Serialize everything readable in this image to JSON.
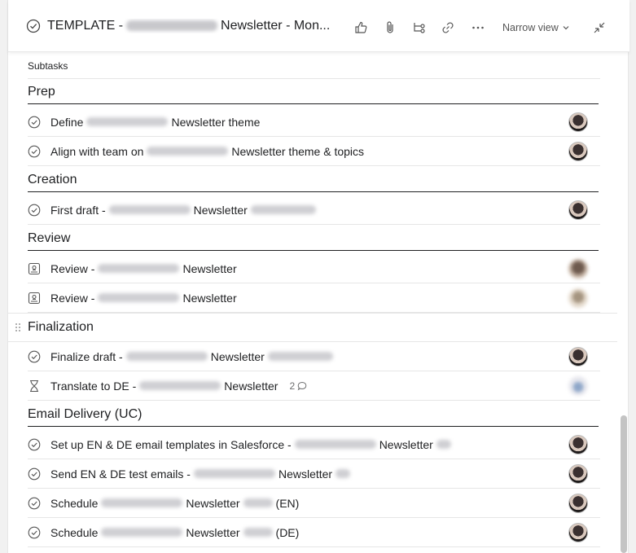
{
  "header": {
    "title_prefix": "TEMPLATE - ",
    "title_suffix": " Newsletter - Mon...",
    "narrow_view": "Narrow view",
    "icons": [
      "like-icon",
      "attachment-icon",
      "subtask-icon",
      "link-icon",
      "more-icon",
      "collapse-icon"
    ]
  },
  "subtasks_label": "Subtasks",
  "sections": {
    "prep": "Prep",
    "creation": "Creation",
    "review": "Review",
    "finalization": "Finalization",
    "email_delivery": "Email Delivery (UC)"
  },
  "rows": {
    "r1": {
      "a": "Define",
      "b": "Newsletter theme"
    },
    "r2": {
      "a": "Align with team on",
      "b": "Newsletter theme & topics"
    },
    "r3": {
      "a": "First draft -",
      "b": "Newsletter"
    },
    "r4": {
      "a": "Review -",
      "b": "Newsletter"
    },
    "r5": {
      "a": "Review -",
      "b": "Newsletter"
    },
    "r6": {
      "a": "Finalize draft -",
      "b": "Newsletter"
    },
    "r7": {
      "a": "Translate to DE -",
      "b": "Newsletter",
      "comments": "2"
    },
    "r8": {
      "a": "Set up EN & DE email templates in Salesforce -",
      "b": "Newsletter"
    },
    "r9": {
      "a": "Send EN & DE test emails -",
      "b": "Newsletter"
    },
    "r10": {
      "a": "Schedule",
      "b": "Newsletter",
      "c": "(EN)"
    },
    "r11": {
      "a": "Schedule",
      "b": "Newsletter",
      "c": "(DE)"
    }
  },
  "colors": {
    "accent": "#1e1f21",
    "muted": "#6d6e6f",
    "divider": "#e6e6e6"
  }
}
